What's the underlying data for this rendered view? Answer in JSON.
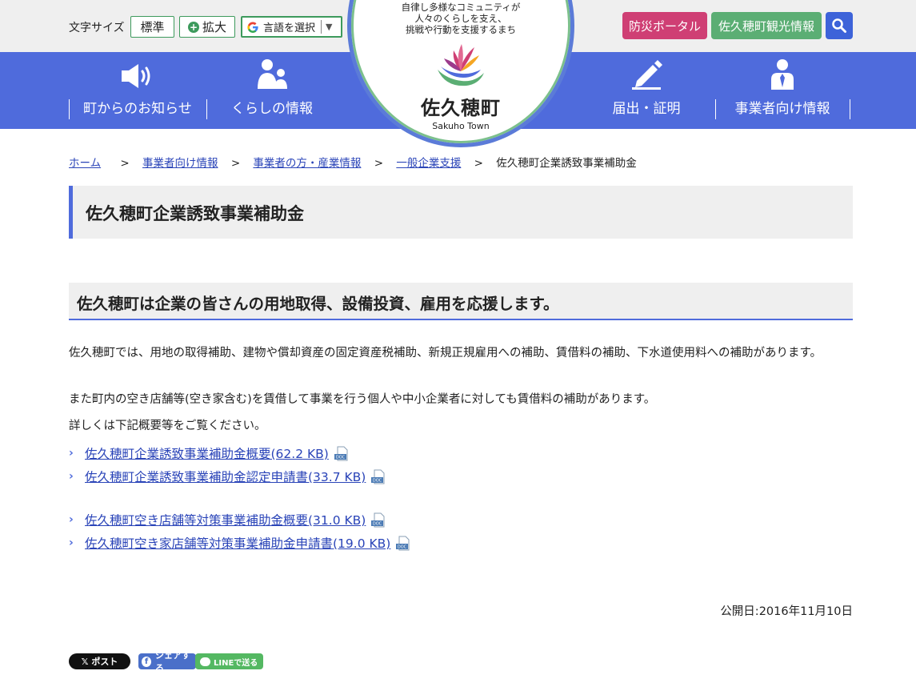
{
  "header": {
    "font_size_label": "文字サイズ",
    "font_std_label": "標準",
    "font_big_label": "拡大",
    "language_label": "言語を選択",
    "bousai_label": "防災ポータル",
    "kanko_label": "佐久穂町観光情報"
  },
  "logo": {
    "tagline_1": "自律し多様なコミュニティが",
    "tagline_2": "人々のくらしを支え、",
    "tagline_3": "挑戦や行動を支援するまち",
    "name": "佐久穂町",
    "name_en": "Sakuho Town"
  },
  "nav": {
    "items": [
      {
        "label": "町からのお知らせ",
        "icon": "megaphone-icon"
      },
      {
        "label": "くらしの情報",
        "icon": "family-icon"
      },
      {
        "label": "届出・証明",
        "icon": "pencil-icon"
      },
      {
        "label": "事業者向け情報",
        "icon": "businessperson-icon"
      }
    ]
  },
  "breadcrumb": {
    "items": [
      "ホーム",
      "事業者向け情報",
      "事業者の方・産業情報",
      "一般企業支援"
    ],
    "current": "佐久穂町企業誘致事業補助金",
    "separator": ">"
  },
  "page": {
    "title": "佐久穂町企業誘致事業補助金",
    "subheading": "佐久穂町は企業の皆さんの用地取得、設備投資、雇用を応援します。",
    "paragraphs": [
      "佐久穂町では、用地の取得補助、建物や償却資産の固定資産税補助、新規正規雇用への補助、賃借料の補助、下水道使用料への補助があります。",
      "また町内の空き店舗等(空き家含む)を賃借して事業を行う個人や中小企業者に対しても賃借料の補助があります。",
      "詳しくは下記概要等をご覧ください。"
    ],
    "links": [
      {
        "label": "佐久穂町企業誘致事業補助金概要(62.2 KB)",
        "icon": "doc-file-icon"
      },
      {
        "label": "佐久穂町企業誘致事業補助金認定申請書(33.7 KB)",
        "icon": "doc-file-icon"
      },
      {
        "label": "佐久穂町空き店舗等対策事業補助金概要(31.0 KB)",
        "icon": "doc-file-icon"
      },
      {
        "label": "佐久穂町空き家店舗等対策事業補助金申請書(19.0 KB)",
        "icon": "doc-file-icon"
      }
    ],
    "published": "公開日:2016年11月10日"
  },
  "sns": {
    "x_label": "𝕏 ポスト",
    "fb_label": "シェアする",
    "line_label": "LINEで送る"
  },
  "colors": {
    "nav_blue": "#4f6bdc",
    "link_blue": "#2a44b8",
    "bousai_pink": "#cf3f74",
    "kanko_green": "#5bae74",
    "font_btn_green": "#3d9a5c"
  }
}
